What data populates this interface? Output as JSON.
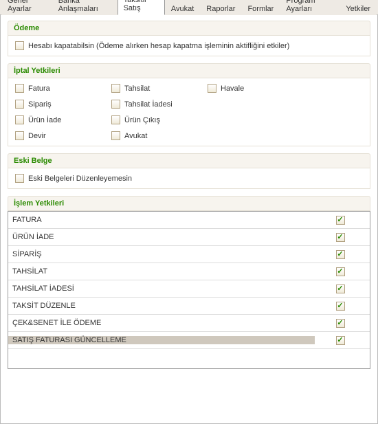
{
  "tabs": [
    {
      "label": "Genel Ayarlar",
      "active": false
    },
    {
      "label": "Banka Anlaşmaları",
      "active": false
    },
    {
      "label": "Taksitli Satış",
      "active": true
    },
    {
      "label": "Avukat",
      "active": false
    },
    {
      "label": "Raporlar",
      "active": false
    },
    {
      "label": "Formlar",
      "active": false
    },
    {
      "label": "Program Ayarları",
      "active": false
    },
    {
      "label": "Yetkiler",
      "active": false
    }
  ],
  "odeme": {
    "title": "Ödeme",
    "hesabi_kapatabilsin": {
      "label": "Hesabı kapatabilsin (Ödeme alırken hesap kapatma işleminin aktifliğini etkiler)",
      "checked": false
    }
  },
  "iptal": {
    "title": "İptal Yetkileri",
    "fatura": {
      "label": "Fatura",
      "checked": false
    },
    "tahsilat": {
      "label": "Tahsilat",
      "checked": false
    },
    "havale": {
      "label": "Havale",
      "checked": false
    },
    "siparis": {
      "label": "Sipariş",
      "checked": false
    },
    "tahsilat_iadesi": {
      "label": "Tahsilat İadesi",
      "checked": false
    },
    "urun_iade": {
      "label": "Ürün İade",
      "checked": false
    },
    "urun_cikis": {
      "label": "Ürün Çıkış",
      "checked": false
    },
    "devir": {
      "label": "Devir",
      "checked": false
    },
    "avukat": {
      "label": "Avukat",
      "checked": false
    }
  },
  "eski_belge": {
    "title": "Eski Belge",
    "duzenleyemesin": {
      "label": "Eski Belgeleri Düzenleyemesin",
      "checked": false
    }
  },
  "islem": {
    "title": "İşlem Yetkileri",
    "rows": [
      {
        "label": "FATURA",
        "checked": true,
        "selected": false
      },
      {
        "label": "ÜRÜN İADE",
        "checked": true,
        "selected": false
      },
      {
        "label": "SİPARİŞ",
        "checked": true,
        "selected": false
      },
      {
        "label": "TAHSİLAT",
        "checked": true,
        "selected": false
      },
      {
        "label": "TAHSİLAT İADESİ",
        "checked": true,
        "selected": false
      },
      {
        "label": "TAKSİT DÜZENLE",
        "checked": true,
        "selected": false
      },
      {
        "label": "ÇEK&SENET İLE ÖDEME",
        "checked": true,
        "selected": false
      },
      {
        "label": "SATIŞ FATURASI GÜNCELLEME",
        "checked": true,
        "selected": true
      }
    ]
  }
}
